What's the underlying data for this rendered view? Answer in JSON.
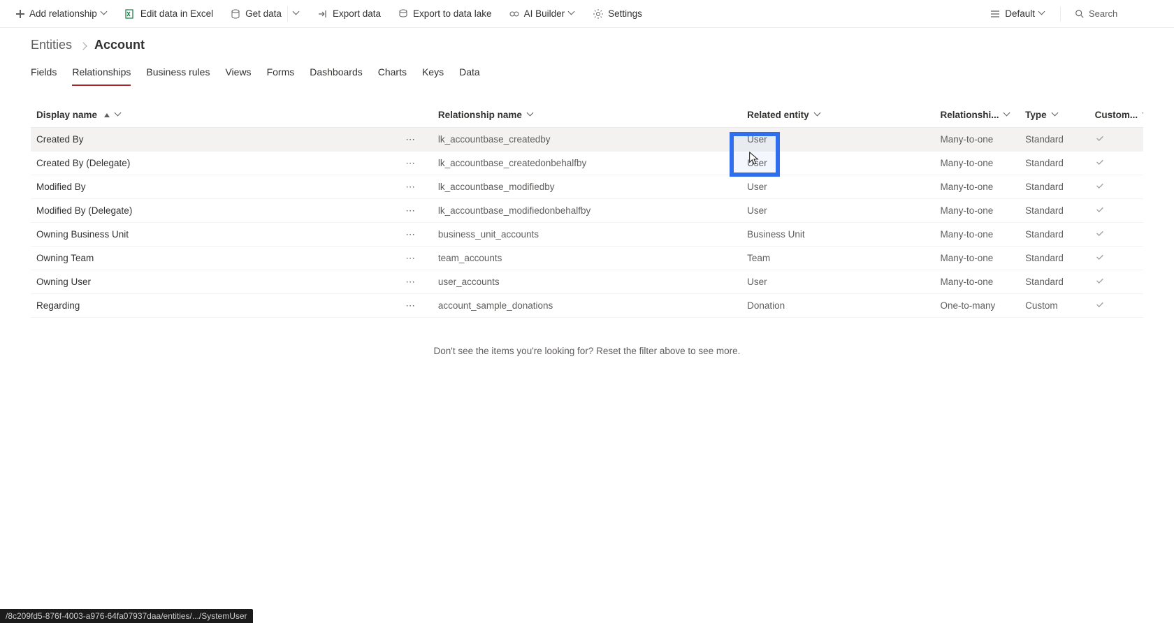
{
  "cmdbar": {
    "add_relationship": "Add relationship",
    "edit_in_excel": "Edit data in Excel",
    "get_data": "Get data",
    "export_data": "Export data",
    "export_data_lake": "Export to data lake",
    "ai_builder": "AI Builder",
    "settings": "Settings",
    "default": "Default",
    "search_placeholder": "Search"
  },
  "breadcrumb": {
    "root": "Entities",
    "current": "Account"
  },
  "pivots": [
    "Fields",
    "Relationships",
    "Business rules",
    "Views",
    "Forms",
    "Dashboards",
    "Charts",
    "Keys",
    "Data"
  ],
  "pivot_active_index": 1,
  "columns": {
    "display_name": "Display name",
    "relationship_name": "Relationship name",
    "related_entity": "Related entity",
    "relationship_type": "Relationshi...",
    "type": "Type",
    "customizable": "Custom..."
  },
  "rows": [
    {
      "display": "Created By",
      "rel": "lk_accountbase_createdby",
      "entity": "User",
      "rtype": "Many-to-one",
      "type": "Standard",
      "custom": true
    },
    {
      "display": "Created By (Delegate)",
      "rel": "lk_accountbase_createdonbehalfby",
      "entity": "User",
      "rtype": "Many-to-one",
      "type": "Standard",
      "custom": true
    },
    {
      "display": "Modified By",
      "rel": "lk_accountbase_modifiedby",
      "entity": "User",
      "rtype": "Many-to-one",
      "type": "Standard",
      "custom": true
    },
    {
      "display": "Modified By (Delegate)",
      "rel": "lk_accountbase_modifiedonbehalfby",
      "entity": "User",
      "rtype": "Many-to-one",
      "type": "Standard",
      "custom": true
    },
    {
      "display": "Owning Business Unit",
      "rel": "business_unit_accounts",
      "entity": "Business Unit",
      "rtype": "Many-to-one",
      "type": "Standard",
      "custom": true
    },
    {
      "display": "Owning Team",
      "rel": "team_accounts",
      "entity": "Team",
      "rtype": "Many-to-one",
      "type": "Standard",
      "custom": true
    },
    {
      "display": "Owning User",
      "rel": "user_accounts",
      "entity": "User",
      "rtype": "Many-to-one",
      "type": "Standard",
      "custom": true
    },
    {
      "display": "Regarding",
      "rel": "account_sample_donations",
      "entity": "Donation",
      "rtype": "One-to-many",
      "type": "Custom",
      "custom": true
    }
  ],
  "hint_text": "Don't see the items you're looking for? Reset the filter above to see more.",
  "status_bar": "/8c209fd5-876f-4003-a976-64fa07937daa/entities/.../SystemUser"
}
